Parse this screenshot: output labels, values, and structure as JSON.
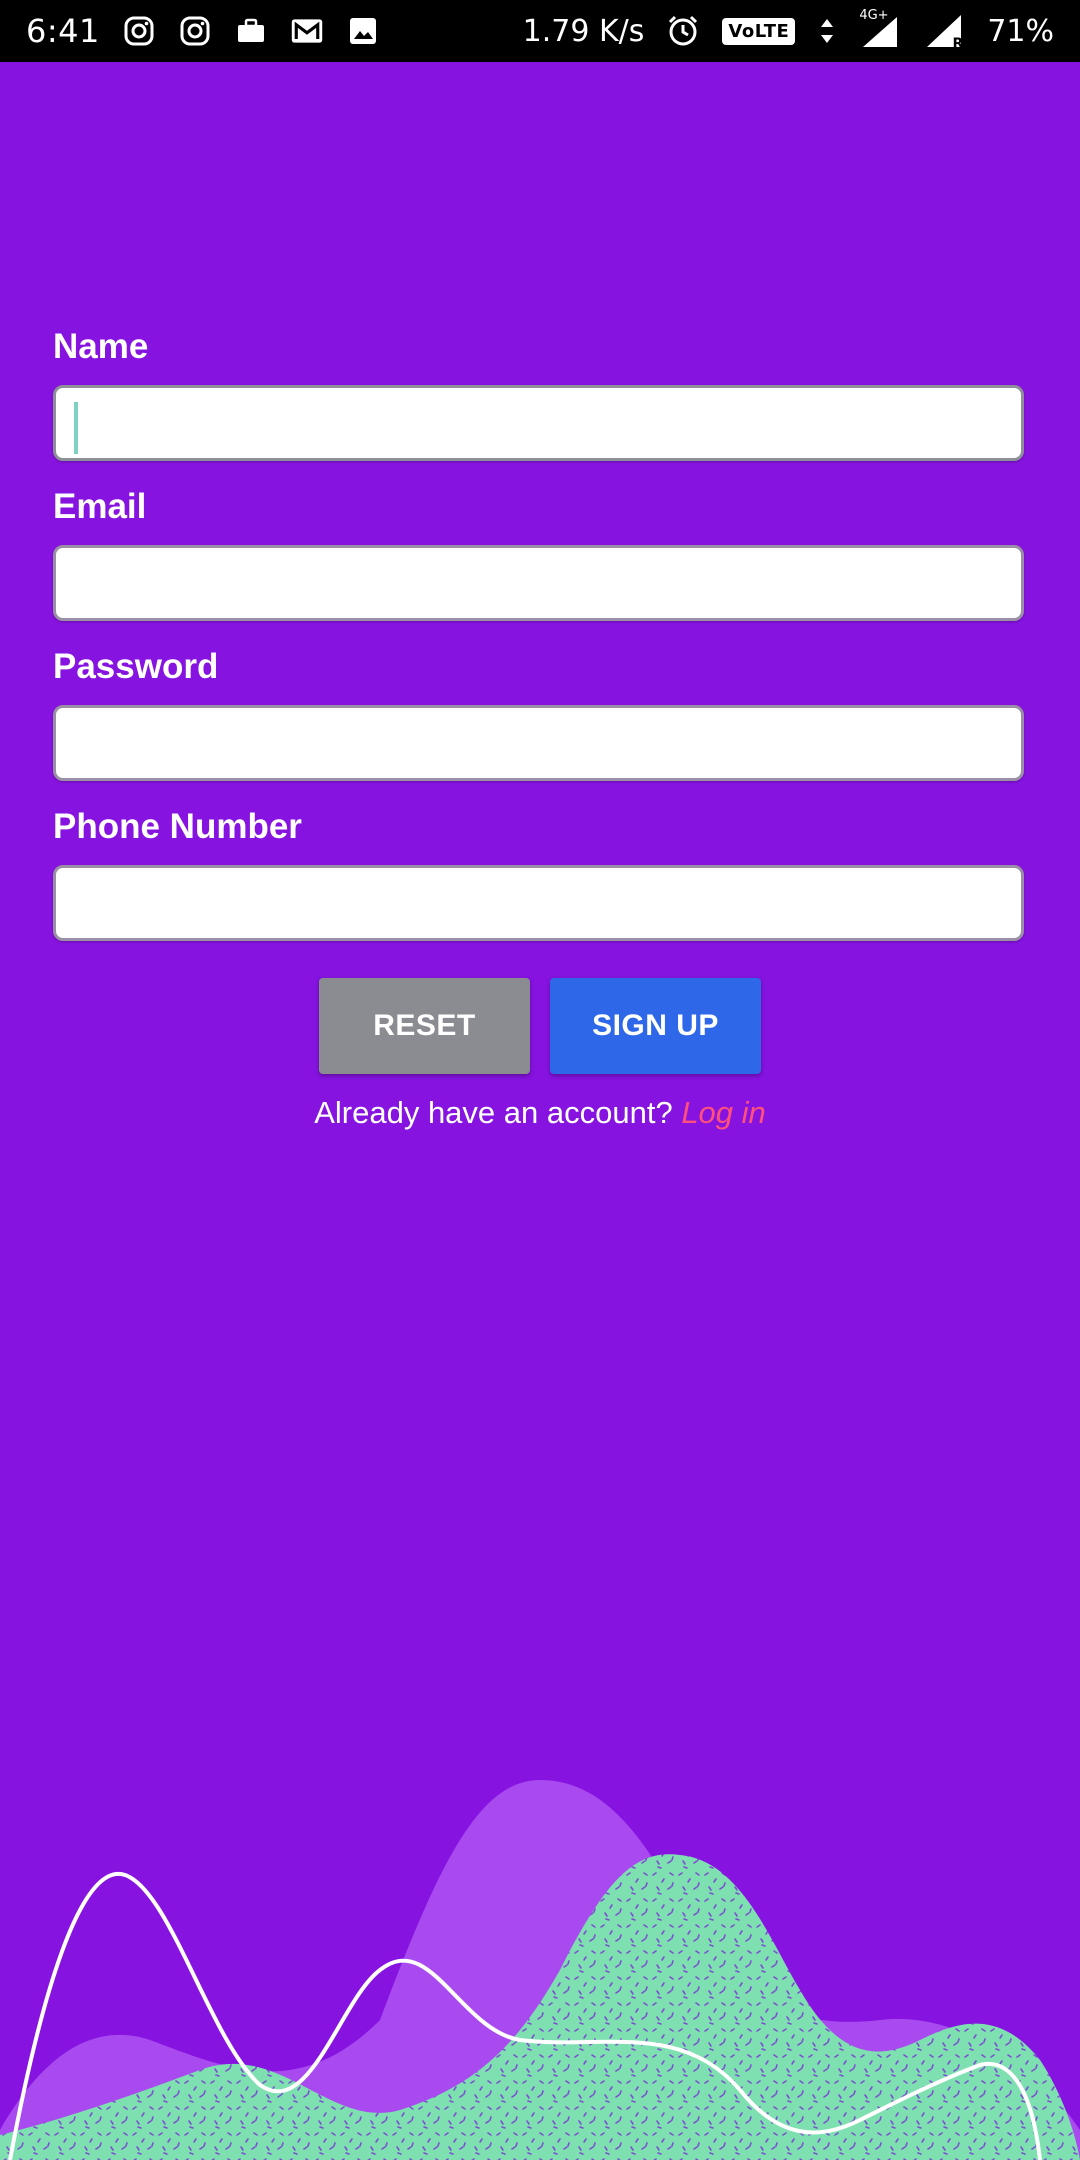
{
  "status_bar": {
    "time": "6:41",
    "left_icons": [
      "instagram-icon",
      "instagram-icon",
      "briefcase-icon",
      "gmail-icon",
      "image-icon"
    ],
    "net_speed": "1.79 K/s",
    "volte_label": "VoLTE",
    "network_type": "4G+",
    "roaming_label": "R",
    "battery": "71%"
  },
  "form": {
    "fields": [
      {
        "label": "Name",
        "value": ""
      },
      {
        "label": "Email",
        "value": ""
      },
      {
        "label": "Password",
        "value": ""
      },
      {
        "label": "Phone Number",
        "value": ""
      }
    ]
  },
  "actions": {
    "reset_label": "RESET",
    "signup_label": "SIGN UP"
  },
  "login_prompt": {
    "text": "Already have an account?",
    "link": "Log in"
  },
  "colors": {
    "background": "#8613e0",
    "reset_button": "#8a8c91",
    "signup_button": "#2e67e8",
    "login_link": "#ff4f7a",
    "wave_light": "#a84aef",
    "wave_green": "#7ee0b0"
  }
}
